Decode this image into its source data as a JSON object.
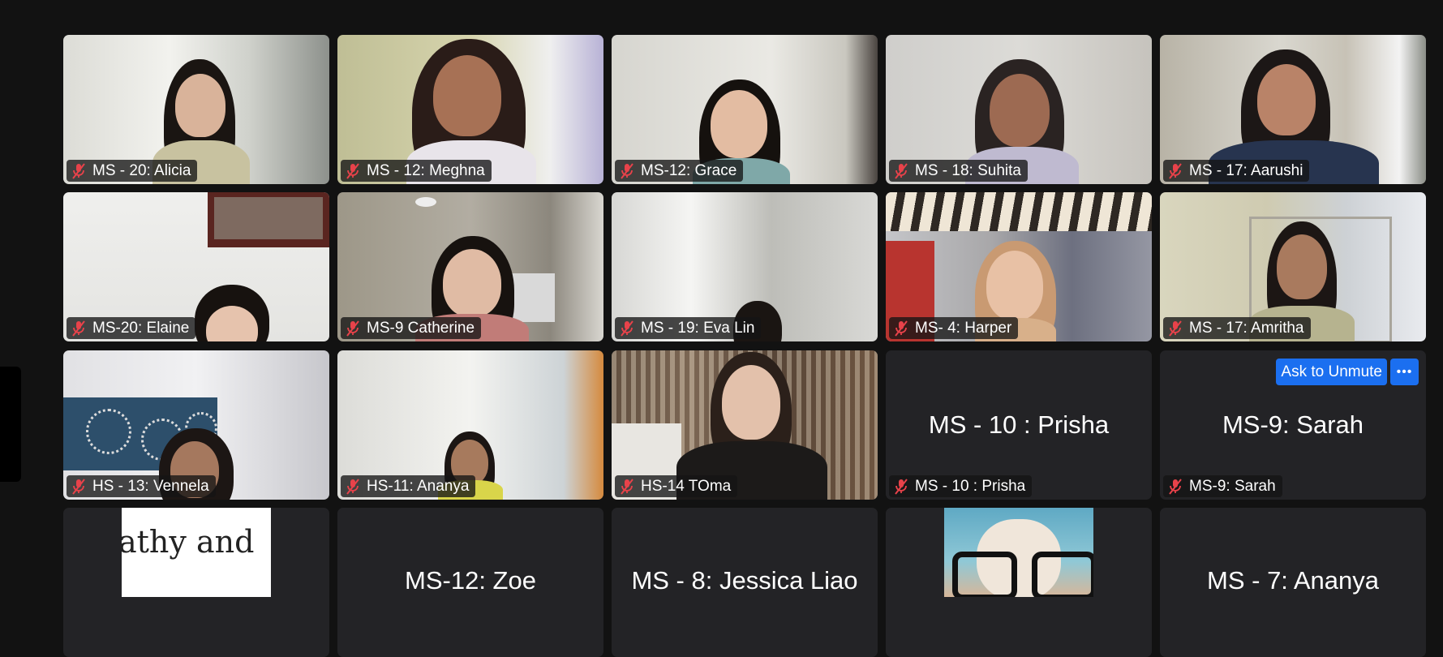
{
  "participants": [
    {
      "name": "MS - 20: Alicia"
    },
    {
      "name": "MS - 12: Meghna"
    },
    {
      "name": "MS-12: Grace"
    },
    {
      "name": "MS - 18: Suhita"
    },
    {
      "name": "MS - 17: Aarushi"
    },
    {
      "name": "MS-20: Elaine"
    },
    {
      "name": "MS-9 Catherine"
    },
    {
      "name": "MS - 19: Eva Lin"
    },
    {
      "name": "MS- 4: Harper"
    },
    {
      "name": "MS - 17: Amritha"
    },
    {
      "name": "HS - 13: Vennela"
    },
    {
      "name": "HS-11: Ananya"
    },
    {
      "name": "HS-14 TOma"
    },
    {
      "name": "MS - 10 : Prisha",
      "display": "MS - 10 : Prisha"
    },
    {
      "name": "MS-9: Sarah",
      "display": "MS-9: Sarah"
    },
    {
      "image_text": "athy and"
    },
    {
      "display": "MS-12: Zoe"
    },
    {
      "display": "MS - 8: Jessica Liao"
    },
    {
      "avatar": "puppy-with-glasses"
    },
    {
      "display": "MS - 7: Ananya"
    }
  ],
  "controls": {
    "ask_to_unmute": "Ask to Unmute",
    "more": "•••"
  },
  "icons": {
    "muted": "muted-mic-icon",
    "more": "more-options-icon"
  },
  "colors": {
    "background": "#121212",
    "tile": "#232326",
    "muted_icon": "#e8424a",
    "button": "#1b6ff0"
  }
}
